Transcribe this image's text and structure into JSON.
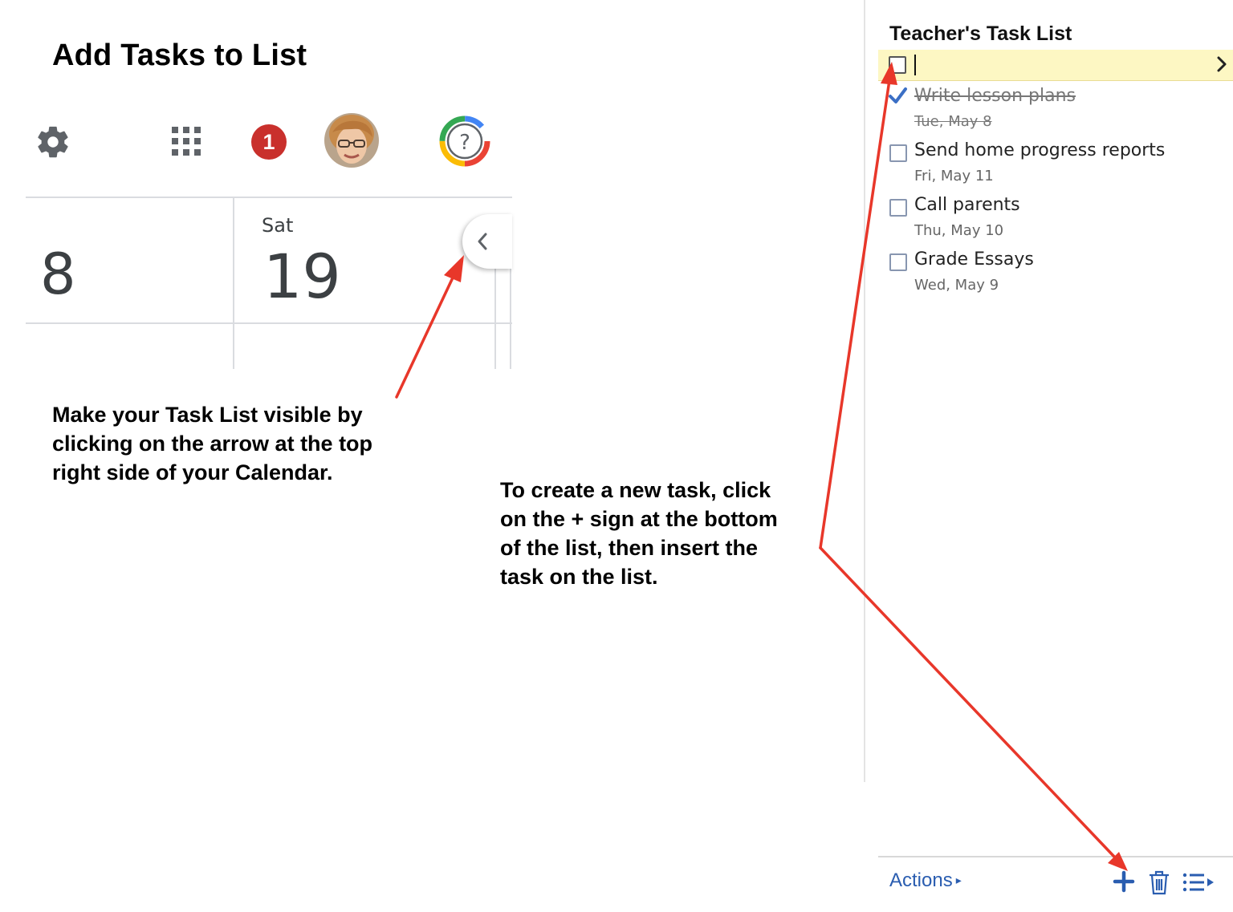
{
  "page_title": "Add Tasks to List",
  "toolbar": {
    "icons": [
      "gear-icon",
      "apps-grid-icon",
      "notification-badge",
      "avatar",
      "help-icon"
    ],
    "notification_count": "1",
    "help_glyph": "?"
  },
  "calendar": {
    "left_day_number": "8",
    "day_name": "Sat",
    "day_number": "19"
  },
  "annotations": {
    "visibility_note": "Make your Task List visible by\nclicking on the arrow at the top\nright side of your Calendar.",
    "create_note": "To create a new task, click\non the + sign at the bottom\nof the list, then insert the\ntask on the list."
  },
  "task_panel": {
    "title": "Teacher's Task List",
    "tasks": [
      {
        "label": "Write lesson plans",
        "date": "Tue, May 8",
        "completed": true
      },
      {
        "label": "Send home progress reports",
        "date": "Fri, May 11",
        "completed": false
      },
      {
        "label": "Call parents",
        "date": "Thu, May 10",
        "completed": false
      },
      {
        "label": "Grade Essays",
        "date": "Wed, May 9",
        "completed": false
      }
    ],
    "footer": {
      "actions_label": "Actions",
      "actions_triangle": "▸"
    }
  },
  "colors": {
    "annotation_arrow": "#e8372a",
    "link_blue": "#2a5db0",
    "new_task_highlight": "#fdf7c3",
    "notification_red": "#c9302c"
  }
}
